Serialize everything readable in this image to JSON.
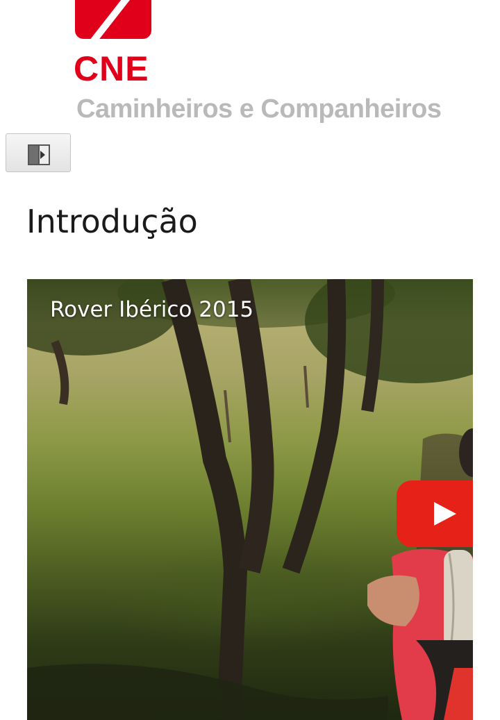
{
  "logo": {
    "brand": "CNE",
    "subtitle": "Caminheiros e Companheiros"
  },
  "toolbar": {
    "sidebar_toggle_icon": "sidebar-toggle-icon"
  },
  "page": {
    "title": "Introdução"
  },
  "video": {
    "title": "Rover Ibérico 2015",
    "play_icon": "youtube-play-icon"
  },
  "colors": {
    "brand_red": "#e1001a",
    "subtitle_gray": "#b9b9b9",
    "play_red": "#e62117"
  }
}
